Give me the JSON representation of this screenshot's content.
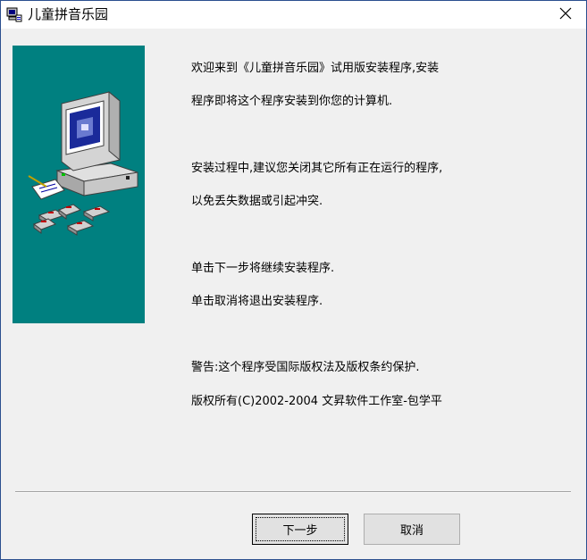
{
  "window": {
    "title": "儿童拼音乐园"
  },
  "message": {
    "lines": [
      "欢迎来到《儿童拼音乐园》试用版安装程序,安装",
      "程序即将这个程序安装到你您的计算机.",
      "安装过程中,建议您关闭其它所有正在运行的程序,",
      "以免丢失数据或引起冲突.",
      "单击下一步将继续安装程序.",
      "单击取消将退出安装程序.",
      "警告:这个程序受国际版权法及版权条约保护.",
      "版权所有(C)2002-2004 文昇软件工作室-包学平"
    ]
  },
  "buttons": {
    "next_label": "下一步",
    "cancel_label": "取消"
  },
  "colors": {
    "side_panel": "#008080",
    "window_bg": "#f0f0f0"
  },
  "icons": {
    "app": "installer-computer-icon",
    "close": "close-icon",
    "illustration": "computer-with-floppy-disks-illustration"
  }
}
